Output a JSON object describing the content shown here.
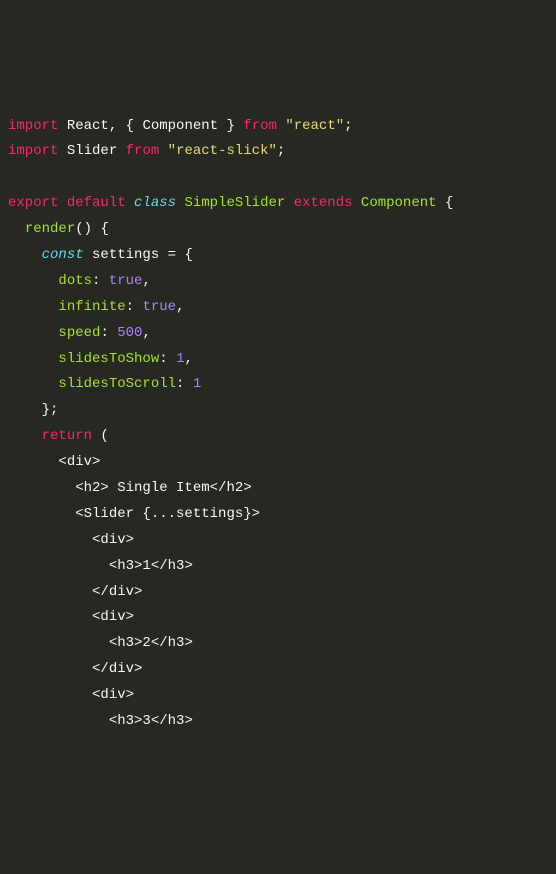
{
  "code": {
    "l1": {
      "import": "import",
      "react": "React",
      "comma": ", { ",
      "component": "Component",
      "brace": " } ",
      "from": "from",
      "str": "\"react\"",
      "semi": ";"
    },
    "l2": {
      "import": "import",
      "slider": "Slider",
      "from": "from",
      "str": "\"react-slick\"",
      "semi": ";"
    },
    "l4": {
      "export": "export",
      "default": "default",
      "class": "class",
      "name": "SimpleSlider",
      "extends": "extends",
      "component": "Component",
      "brace": " {"
    },
    "l5": {
      "render": "render",
      "text": "() {"
    },
    "l6": {
      "const": "const",
      "text": " settings = {"
    },
    "l7": {
      "key": "dots",
      "colon": ": ",
      "val": "true",
      "comma": ","
    },
    "l8": {
      "key": "infinite",
      "colon": ": ",
      "val": "true",
      "comma": ","
    },
    "l9": {
      "key": "speed",
      "colon": ": ",
      "val": "500",
      "comma": ","
    },
    "l10": {
      "key": "slidesToShow",
      "colon": ": ",
      "val": "1",
      "comma": ","
    },
    "l11": {
      "key": "slidesToScroll",
      "colon": ": ",
      "val": "1"
    },
    "l12": {
      "text": "};"
    },
    "l13": {
      "return": "return",
      "text": " ("
    },
    "l14": {
      "text": "<div>"
    },
    "l15": {
      "text": "<h2> Single Item</h2>"
    },
    "l16": {
      "text": "<Slider {...settings}>"
    },
    "l17": {
      "text": "<div>"
    },
    "l18": {
      "text": "<h3>1</h3>"
    },
    "l19": {
      "text": "</div>"
    },
    "l20": {
      "text": "<div>"
    },
    "l21": {
      "text": "<h3>2</h3>"
    },
    "l22": {
      "text": "</div>"
    },
    "l23": {
      "text": "<div>"
    },
    "l24": {
      "text": "<h3>3</h3>"
    }
  }
}
